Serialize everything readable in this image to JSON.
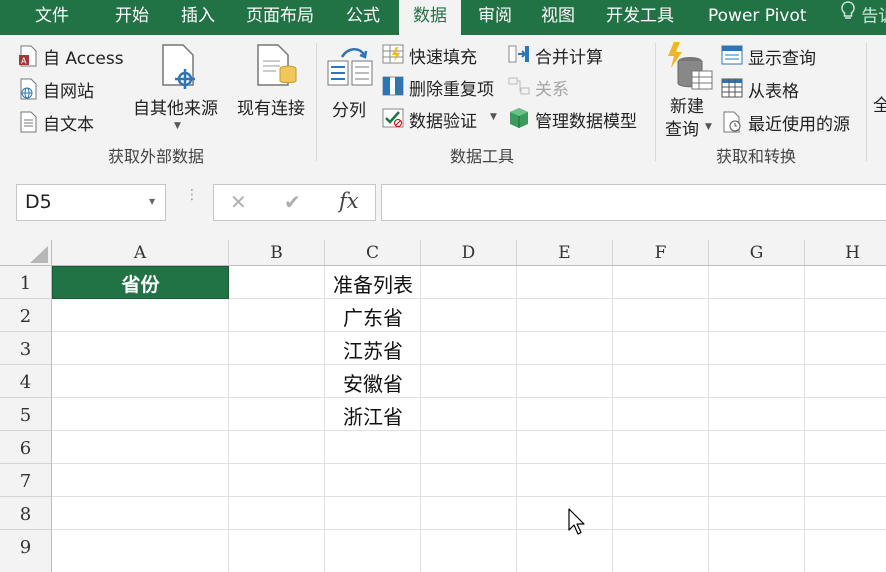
{
  "tabs": [
    "文件",
    "开始",
    "插入",
    "页面布局",
    "公式",
    "数据",
    "审阅",
    "视图",
    "开发工具",
    "Power Pivot",
    "告诉"
  ],
  "active_tab": "数据",
  "ribbon": {
    "get_external": {
      "access": "自 Access",
      "web": "自网站",
      "text": "自文本",
      "other_sources": "自其他来源",
      "existing": "现有连接",
      "group_label": "获取外部数据"
    },
    "data_tools": {
      "split": "分列",
      "flash_fill": "快速填充",
      "remove_dup": "删除重复项",
      "validation": "数据验证",
      "consolidate": "合并计算",
      "relations": "关系",
      "data_model": "管理数据模型",
      "group_label": "数据工具"
    },
    "get_transform": {
      "new_query_1": "新建",
      "new_query_2": "查询",
      "show_queries": "显示查询",
      "from_table": "从表格",
      "recent_sources": "最近使用的源",
      "group_label": "获取和转换"
    },
    "edge_text": "全"
  },
  "formula_bar": {
    "name_box": "D5",
    "cancel_symbol": "✕",
    "enter_symbol": "✔",
    "fx_symbol": "fx",
    "formula": ""
  },
  "columns": [
    "A",
    "B",
    "C",
    "D",
    "E",
    "F",
    "G",
    "H"
  ],
  "rows": [
    "1",
    "2",
    "3",
    "4",
    "5",
    "6",
    "7",
    "8",
    "9"
  ],
  "cells": {
    "A1": "省份",
    "C1": "准备列表",
    "C2": "广东省",
    "C3": "江苏省",
    "C4": "安徽省",
    "C5": "浙江省"
  },
  "colors": {
    "accent": "#217346",
    "header_fill": "#217346",
    "header_text": "#ffffff"
  }
}
